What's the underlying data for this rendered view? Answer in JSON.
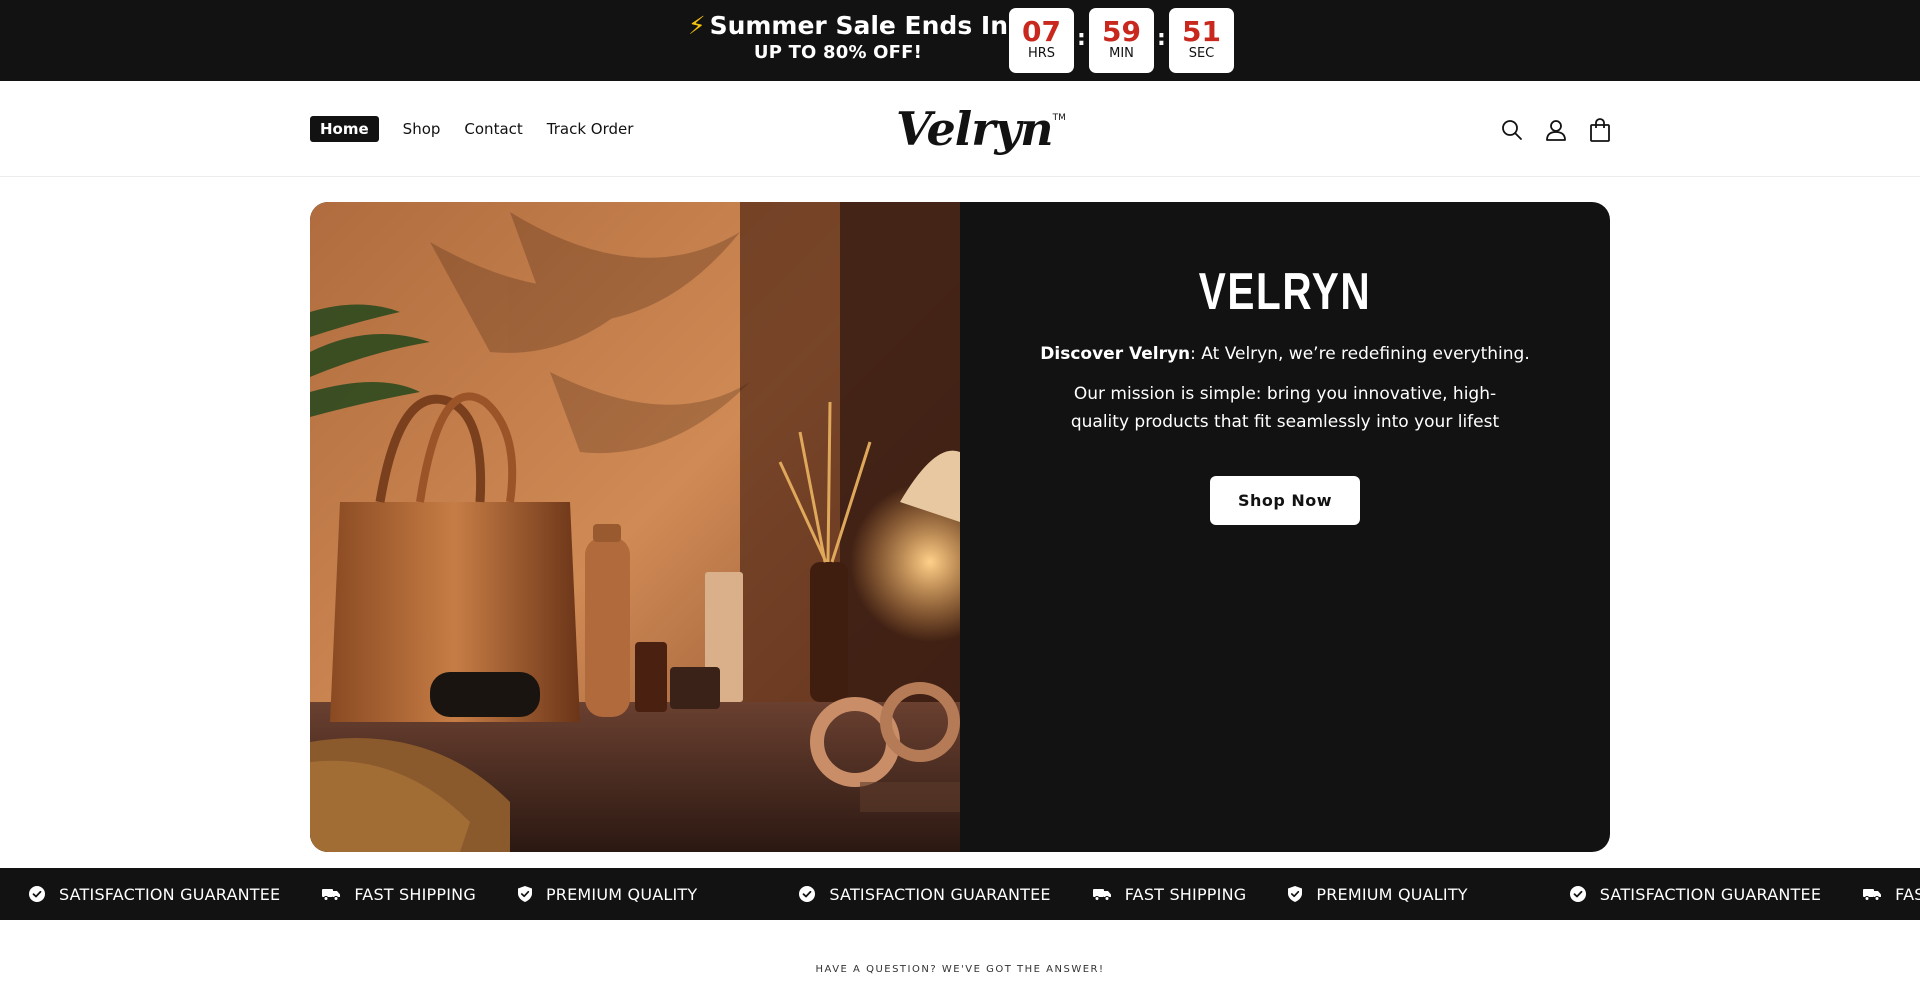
{
  "announcement": {
    "bolt": "⚡",
    "title": "Summer Sale Ends In:",
    "subtitle": "UP TO 80% OFF!",
    "timer": [
      {
        "value": "07",
        "unit": "HRS"
      },
      {
        "value": "59",
        "unit": "MIN"
      },
      {
        "value": "51",
        "unit": "SEC"
      }
    ],
    "separator": ":"
  },
  "header": {
    "nav": [
      {
        "label": "Home",
        "active": true
      },
      {
        "label": "Shop"
      },
      {
        "label": "Contact"
      },
      {
        "label": "Track Order"
      }
    ],
    "logo": "Velryn",
    "logo_tm": "TM",
    "icons": [
      "search-icon",
      "account-icon",
      "cart-icon"
    ]
  },
  "hero": {
    "title": "VELRYN",
    "lead_bold": "Discover Velryn",
    "lead_rest": ": At Velryn, we’re redefining everything.",
    "mission": "Our mission is simple: bring you innovative, high-quality products that fit seamlessly into your lifest",
    "button": "Shop Now"
  },
  "marquee": {
    "items": [
      {
        "icon": "check-circle-icon",
        "label": "SATISFACTION GUARANTEE"
      },
      {
        "icon": "truck-icon",
        "label": "FAST SHIPPING"
      },
      {
        "icon": "shield-check-icon",
        "label": "PREMIUM QUALITY"
      }
    ]
  },
  "faq": {
    "eyebrow": "HAVE A QUESTION? WE'VE GOT THE ANSWER!"
  },
  "colors": {
    "dark": "#121212",
    "accent_red": "#c8281e",
    "bolt_yellow": "#f4c20d"
  }
}
